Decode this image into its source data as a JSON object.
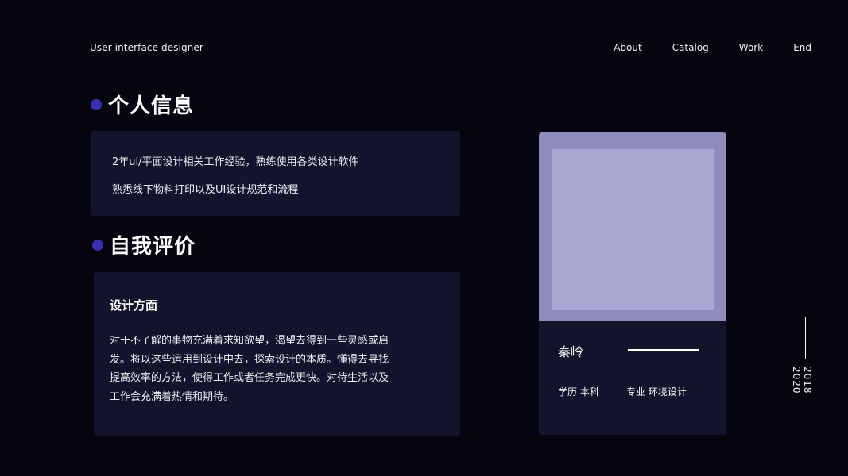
{
  "header": {
    "brand": "User interface designer",
    "nav": [
      "About",
      "Catalog",
      "Work",
      "End"
    ]
  },
  "personal_info": {
    "title": "个人信息",
    "lines": [
      "2年ui/平面设计相关工作经验，熟练使用各类设计软件",
      "熟悉线下物料打印以及UI设计规范和流程"
    ]
  },
  "self_evaluation": {
    "title": "自我评价",
    "subtitle": "设计方面",
    "body": "对于不了解的事物充满着求知欲望，渴望去得到一些灵感或启发。将以这些运用到设计中去，探索设计的本质。懂得去寻找提高效率的方法，使得工作或者任务完成更快。对待生活以及工作会充满着热情和期待。"
  },
  "profile": {
    "name": "秦岭",
    "education": "学历 本科",
    "major": "专业  环境设计"
  },
  "years": "2018 — 2020",
  "colors": {
    "background": "#05040f",
    "card": "#14132c",
    "accent_dot": "#3a2fb0",
    "photo_frame": "#8d8cba",
    "photo": "#a9a8d3"
  }
}
